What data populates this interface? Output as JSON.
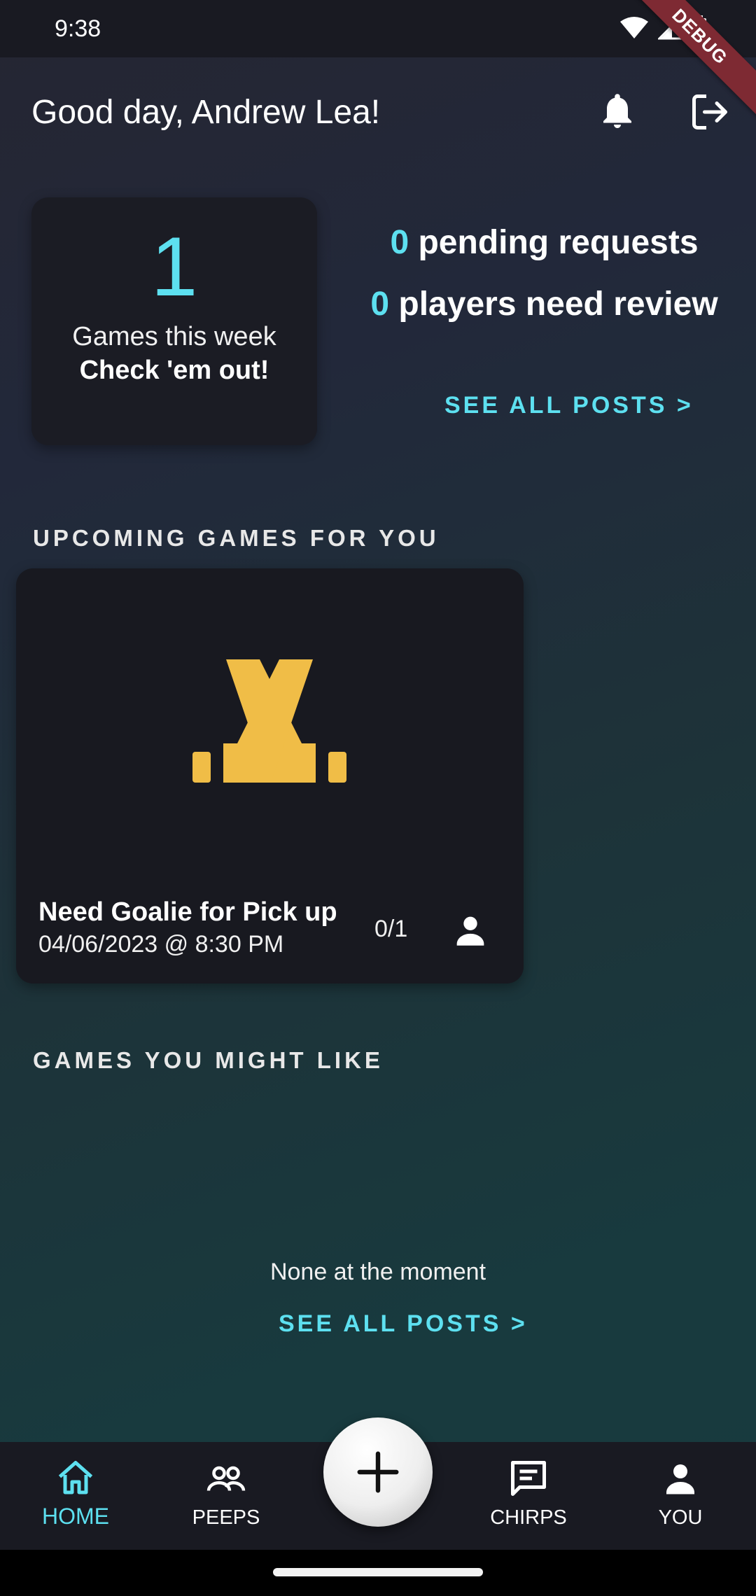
{
  "status_bar": {
    "time": "9:38",
    "debug_label": "DEBUG"
  },
  "header": {
    "greeting": "Good day, Andrew Lea!"
  },
  "summary": {
    "games_count": "1",
    "games_label": "Games this week",
    "games_cta": "Check 'em out!",
    "pending_count": "0",
    "pending_label": "pending requests",
    "review_count": "0",
    "review_label": "players need review",
    "see_all": "SEE ALL POSTS >"
  },
  "upcoming": {
    "section_title": "UPCOMING GAMES FOR YOU",
    "games": [
      {
        "title": "Need Goalie for Pick up",
        "datetime": "04/06/2023 @ 8:30 PM",
        "players": "0/1"
      }
    ]
  },
  "suggestions": {
    "section_title": "GAMES YOU MIGHT LIKE",
    "empty_text": "None at the moment",
    "see_all": "SEE ALL POSTS >"
  },
  "nav": {
    "items": [
      {
        "label": "HOME",
        "icon": "home-icon"
      },
      {
        "label": "PEEPS",
        "icon": "people-icon"
      },
      {
        "label": "CHIRPS",
        "icon": "chat-icon"
      },
      {
        "label": "YOU",
        "icon": "person-icon"
      }
    ],
    "active": "HOME",
    "fab_icon": "plus-icon"
  },
  "colors": {
    "accent": "#5de0f0",
    "logo": "#f0bd47",
    "card_bg": "#1b1c24",
    "nav_bg": "#191a22",
    "ribbon": "#7e2a33"
  }
}
